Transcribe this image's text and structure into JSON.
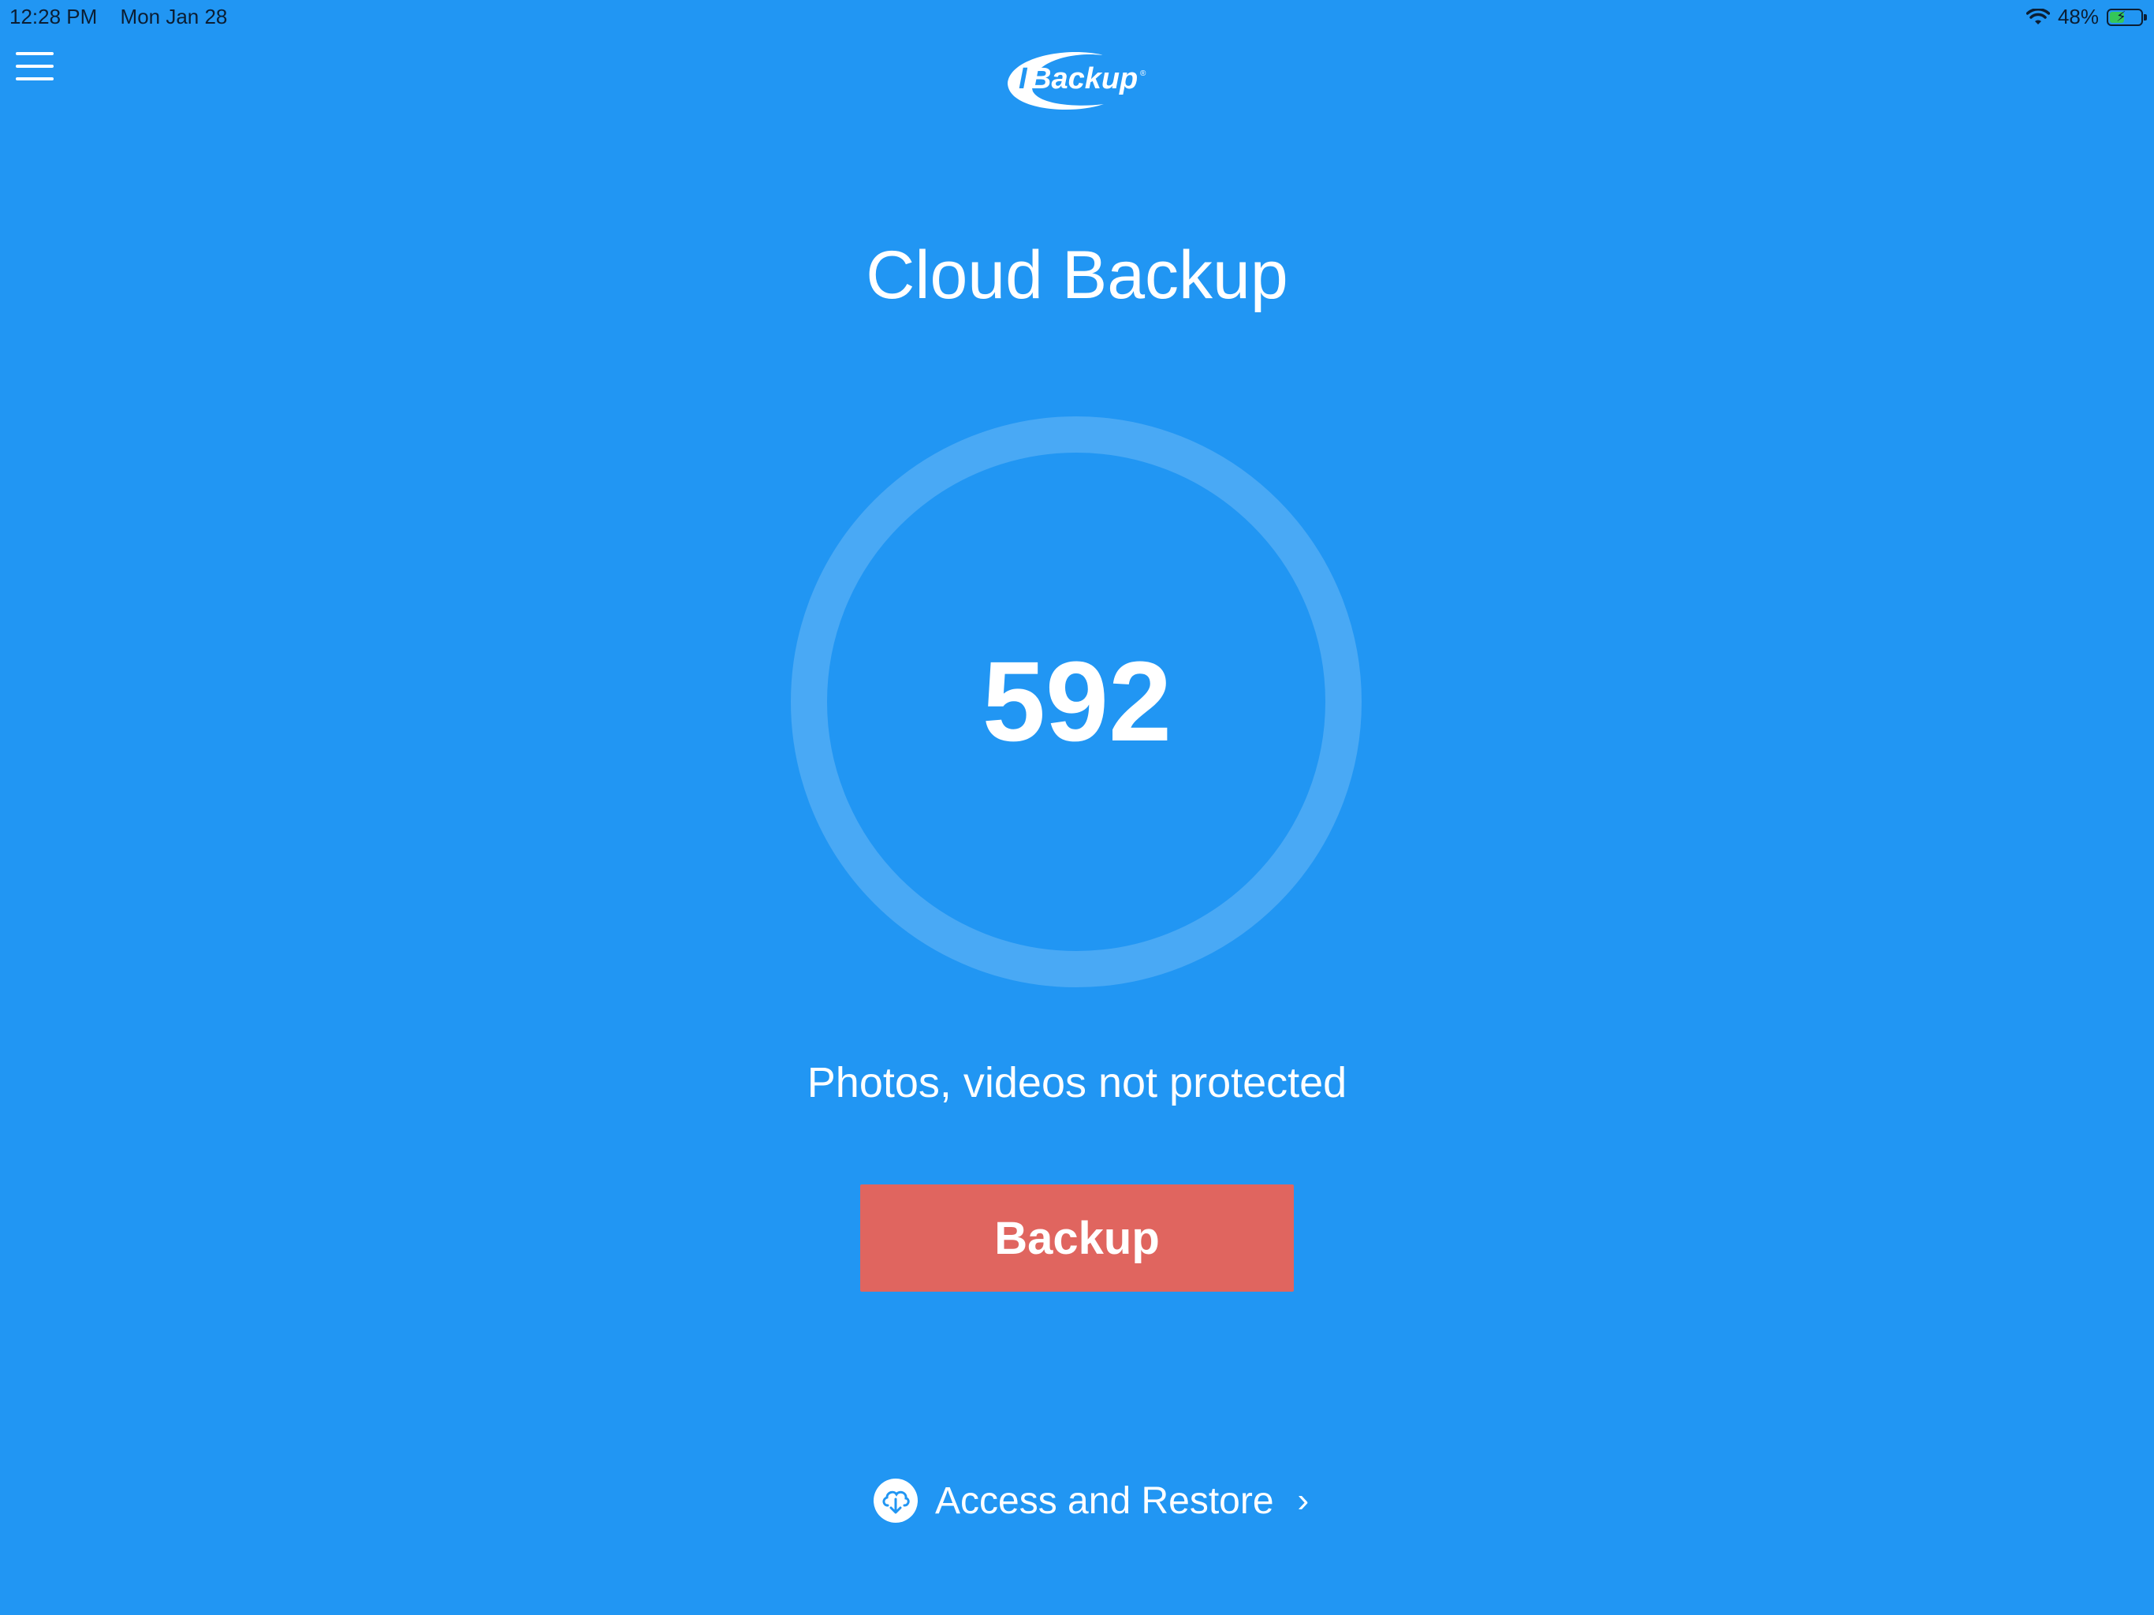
{
  "status_bar": {
    "time": "12:28 PM",
    "date": "Mon Jan 28",
    "battery_percent": "48%",
    "battery_level": 0.48,
    "icons": [
      "wifi-icon",
      "battery-icon"
    ]
  },
  "header": {
    "menu_icon": "hamburger-menu-icon",
    "logo_text": "IBackup"
  },
  "main": {
    "title": "Cloud Backup",
    "count": "592",
    "status_text": "Photos, videos not protected",
    "backup_label": "Backup",
    "restore_label": "Access and Restore",
    "restore_icon": "cloud-download-icon",
    "chevron": "›"
  },
  "colors": {
    "background": "#2196F3",
    "backup_button": "#E0655F",
    "ring_track": "rgba(255,255,255,0.18)",
    "battery_fill": "#34c759"
  }
}
